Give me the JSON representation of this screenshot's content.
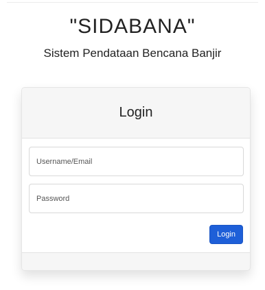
{
  "header": {
    "app_name": "\"SIDABANA\"",
    "subtitle": "Sistem Pendataan Bencana Banjir"
  },
  "login_card": {
    "title": "Login",
    "username_placeholder": "Username/Email",
    "password_placeholder": "Password",
    "login_button_label": "Login"
  },
  "colors": {
    "primary_button": "#1e5fd8",
    "card_header_bg": "#f6f6f6"
  }
}
